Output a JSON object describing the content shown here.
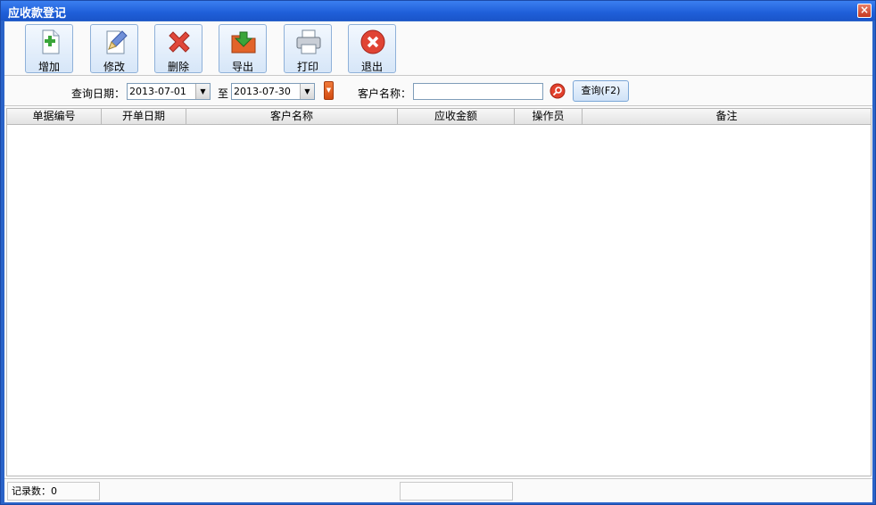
{
  "window": {
    "title": "应收款登记",
    "close_glyph": "×"
  },
  "toolbar": {
    "buttons": [
      {
        "label": "增加",
        "icon": "add-document-icon"
      },
      {
        "label": "修改",
        "icon": "edit-pencil-icon"
      },
      {
        "label": "删除",
        "icon": "delete-x-icon"
      },
      {
        "label": "导出",
        "icon": "export-folder-icon"
      },
      {
        "label": "打印",
        "icon": "printer-icon"
      },
      {
        "label": "退出",
        "icon": "exit-icon"
      }
    ]
  },
  "filter": {
    "date_label": "查询日期：",
    "date_from": "2013-07-01",
    "to_label": "至",
    "date_to": "2013-07-30",
    "customer_label": "客户名称：",
    "customer_value": "",
    "query_button": "查询(F2)"
  },
  "grid": {
    "columns": [
      "单据编号",
      "开单日期",
      "客户名称",
      "应收金额",
      "操作员",
      "备注"
    ],
    "rows": []
  },
  "status": {
    "record_count": "记录数：0",
    "middle": ""
  },
  "colors": {
    "title_bar": "#1f5fd9",
    "accent_button": "#cfe2f7"
  }
}
